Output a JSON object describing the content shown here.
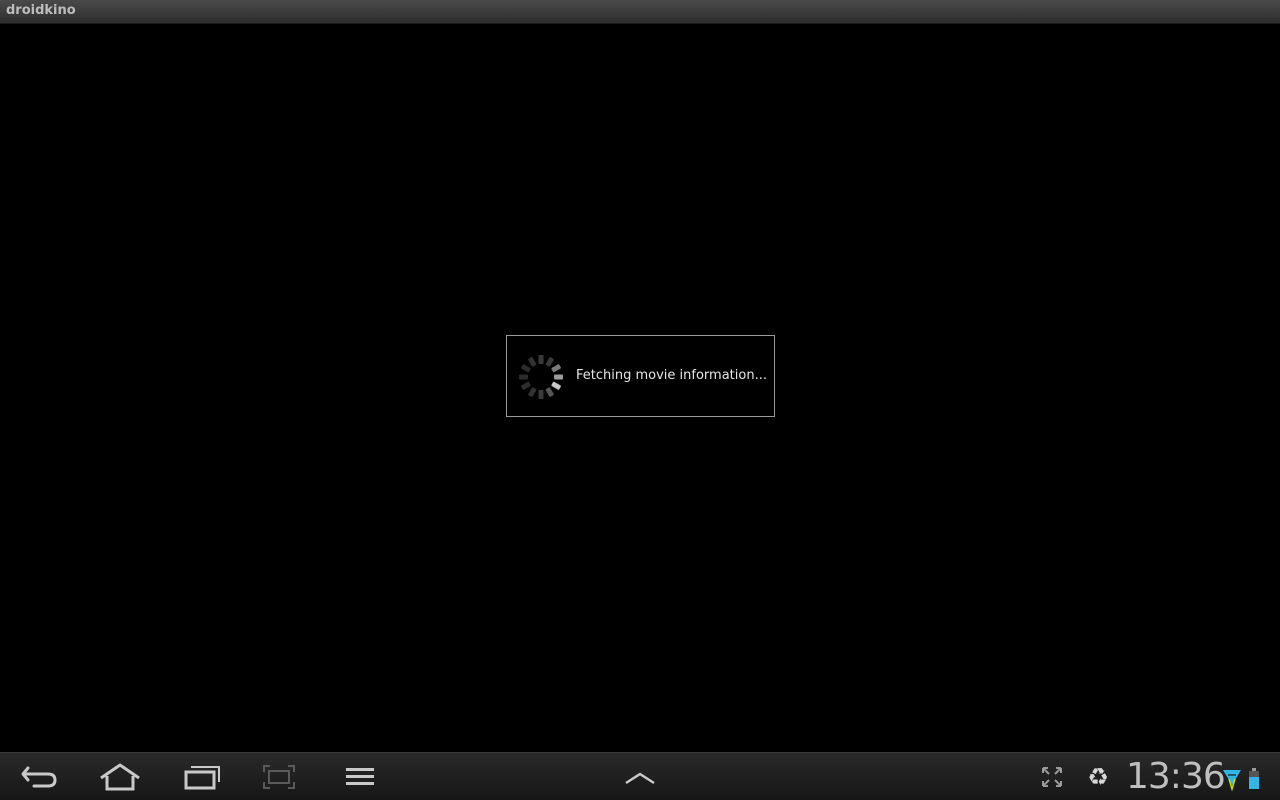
{
  "title_bar": {
    "app_title": "droidkino"
  },
  "dialog": {
    "message": "Fetching movie information..."
  },
  "system_bar": {
    "clock": "13:36",
    "icons": {
      "back": "back-arrow-icon",
      "home": "home-icon",
      "recent": "recent-apps-icon",
      "screenshot": "screenshot-icon",
      "menu": "menu-icon",
      "up": "chevron-up-icon",
      "fullscreen": "fullscreen-icon",
      "recycle": "recycle-icon",
      "wifi": "wifi-icon",
      "battery": "battery-icon"
    }
  },
  "colors": {
    "background": "#000000",
    "wifi_accent": "#33b5e5",
    "battery_accent": "#33b5e5",
    "bar": "#222222"
  }
}
